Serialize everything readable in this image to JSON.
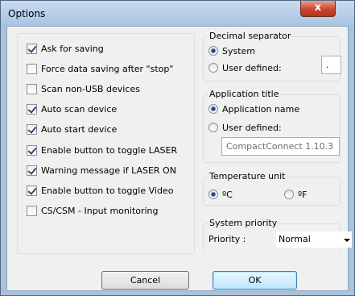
{
  "window": {
    "title": "Options",
    "close_glyph": "x"
  },
  "options": [
    {
      "label": "Ask for saving",
      "checked": true
    },
    {
      "label": "Force data saving after \"stop\"",
      "checked": false
    },
    {
      "label": "Scan non-USB devices",
      "checked": false
    },
    {
      "label": "Auto scan device",
      "checked": true
    },
    {
      "label": "Auto start device",
      "checked": true
    },
    {
      "label": "Enable button to toggle LASER",
      "checked": true
    },
    {
      "label": "Warning message if LASER ON",
      "checked": true
    },
    {
      "label": "Enable button to toggle Video",
      "checked": true
    },
    {
      "label": "CS/CSM - Input monitoring",
      "checked": false
    }
  ],
  "decimal_separator": {
    "title": "Decimal separator",
    "system_label": "System",
    "user_label": "User defined:",
    "selected": "system",
    "value": "."
  },
  "application_title": {
    "title": "Application title",
    "app_name_label": "Application name",
    "user_label": "User defined:",
    "selected": "app_name",
    "value": "CompactConnect 1.10.3"
  },
  "temperature_unit": {
    "title": "Temperature unit",
    "celsius_label": "ºC",
    "fahrenheit_label": "ºF",
    "selected": "celsius"
  },
  "system_priority": {
    "title": "System priority",
    "priority_label": "Priority :",
    "priority_value": "Normal"
  },
  "buttons": {
    "cancel": "Cancel",
    "ok": "OK"
  }
}
